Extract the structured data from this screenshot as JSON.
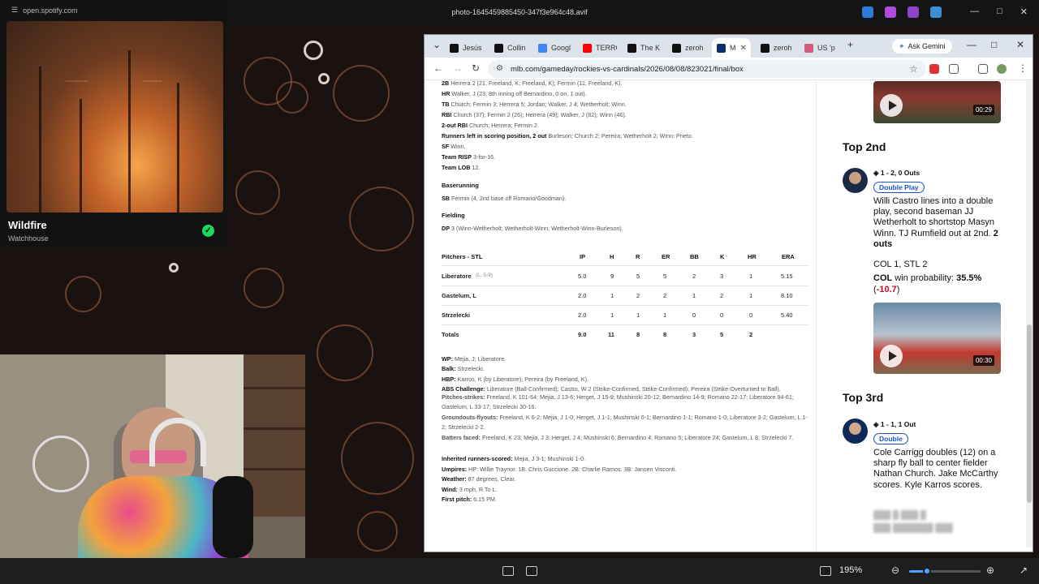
{
  "viewer": {
    "title": "photo-1645459885450-347f3e964c48.avif",
    "zoom": "195%",
    "zoom_level": 0.25
  },
  "spotify": {
    "url": "open.spotify.com",
    "track": "Wildfire",
    "artist": "Watchhouse"
  },
  "browser": {
    "tabs": [
      {
        "label": "Jesús",
        "favicon": "x-icon"
      },
      {
        "label": "Collin",
        "favicon": "x-icon"
      },
      {
        "label": "Googl",
        "favicon": "google-icon"
      },
      {
        "label": "TERRC",
        "favicon": "youtube-icon"
      },
      {
        "label": "The K",
        "favicon": "x-icon"
      },
      {
        "label": "zeroh",
        "favicon": "x-icon"
      },
      {
        "label": "M",
        "favicon": "mlb-icon",
        "active": true
      },
      {
        "label": "zeroh",
        "favicon": "x-icon"
      },
      {
        "label": "US 'p",
        "favicon": "shield-icon"
      }
    ],
    "gemini_label": "Ask Gemini",
    "url": "mlb.com/gameday/rockies-vs-cardinals/2026/08/08/823021/final/box"
  },
  "box": {
    "batting_lines": [
      {
        "label": "2B",
        "text": "Herrera 2 (21, Freeland, K; Freeland, K); Fermin (11, Freeland, K)."
      },
      {
        "label": "HR",
        "text": "Walker, J (23, 8th inning off Bernardino, 0 on, 1 out)."
      },
      {
        "label": "TB",
        "text": "Church; Fermin 3; Herrera 5; Jordan; Walker, J 4; Wetherholt; Winn."
      },
      {
        "label": "RBI",
        "text": "Church (37); Fermin 2 (26); Herrera (49); Walker, J (82); Winn (46)."
      },
      {
        "label": "2-out RBI",
        "text": "Church; Herrera; Fermin 2."
      },
      {
        "label": "Runners left in scoring position, 2 out",
        "text": "Burleson; Church 2; Pereira; Wetherholt 2; Winn; Prieto."
      },
      {
        "label": "SF",
        "text": "Winn."
      },
      {
        "label": "Team RISP",
        "text": "3-for-16."
      },
      {
        "label": "Team LOB",
        "text": "12."
      }
    ],
    "baserunning_title": "Baserunning",
    "baserunning": {
      "label": "SB",
      "text": "Fermin (4, 2nd base off Romano/Goodman)."
    },
    "fielding_title": "Fielding",
    "fielding": {
      "label": "DP",
      "text": "3 (Winn-Wetherholt; Wetherholt-Winn; Wetherholt-Winn-Burleson)."
    },
    "pitchers": {
      "header": [
        "Pitchers - STL",
        "IP",
        "H",
        "R",
        "ER",
        "BB",
        "K",
        "HR",
        "ERA"
      ],
      "rows": [
        {
          "name": "Liberatore",
          "note": "(L, 5-9)",
          "stats": [
            "5.0",
            "9",
            "5",
            "5",
            "2",
            "3",
            "1",
            "5.15"
          ]
        },
        {
          "name": "Gastelum, L",
          "note": "",
          "stats": [
            "2.0",
            "1",
            "2",
            "2",
            "1",
            "2",
            "1",
            "8.10"
          ]
        },
        {
          "name": "Strzelecki",
          "note": "",
          "stats": [
            "2.0",
            "1",
            "1",
            "1",
            "0",
            "0",
            "0",
            "5.40"
          ]
        },
        {
          "name": "Totals",
          "note": "",
          "stats": [
            "9.0",
            "11",
            "8",
            "8",
            "3",
            "5",
            "2",
            ""
          ]
        }
      ]
    },
    "game_notes": [
      {
        "label": "WP:",
        "text": "Mejia, J; Liberatore."
      },
      {
        "label": "Balk:",
        "text": "Strzelecki."
      },
      {
        "label": "HBP:",
        "text": "Karros, K (by Liberatore); Pereira (by Freeland, K)."
      },
      {
        "label": "ABS Challenge:",
        "text": "Liberatore (Ball-Confirmed); Castro, W 2 (Strike-Confirmed, Strike-Confirmed); Pereira (Strike-Overturned to Ball)."
      },
      {
        "label": "Pitches-strikes:",
        "text": "Freeland, K 101-64; Mejia, J 13-6; Herget, J 15-9; Mushinski 20-12; Bernardino 14-9; Romano 22-17; Liberatore 94-61; Gastelum, L 33-17; Strzelecki 30-16."
      },
      {
        "label": "Groundouts-flyouts:",
        "text": "Freeland, K 6-2; Mejia, J 1-0; Herget, J 1-1; Mushinski 0-1; Bernardino 1-1; Romano 1-0; Liberatore 3-2; Gastelum, L 1-2; Strzelecki 2-2."
      },
      {
        "label": "Batters faced:",
        "text": "Freeland, K 23; Mejia, J 3; Herget, J 4; Mushinski 6; Bernardino 4; Romano 5; Liberatore 24; Gastelum, L 8; Strzelecki 7."
      },
      {
        "label": "Inherited runners-scored:",
        "text": "Mejia, J 3-1; Mushinski 1-0."
      },
      {
        "label": "Umpires:",
        "text": "HP: Willie Traynor. 1B: Chris Guccione. 2B: Charlie Ramos. 3B: Jansen Visconti."
      },
      {
        "label": "Weather:",
        "text": "87 degrees, Clear."
      },
      {
        "label": "Wind:",
        "text": "3 mph, R To L."
      },
      {
        "label": "First pitch:",
        "text": "6:15 PM."
      }
    ]
  },
  "pbp": {
    "video1_duration": "00:29",
    "top2": {
      "inning": "Top 2nd",
      "count": "1 - 2, 0 Outs",
      "badge": "Double Play",
      "desc": "Willi Castro lines into a double play, second baseman JJ Wetherholt to shortstop Masyn Winn. TJ Rumfield out at 2nd.",
      "outs": "2 outs",
      "score": "COL 1, STL 2",
      "wp_team": "COL",
      "wp_label": "win probability:",
      "wp_value": "35.5%",
      "wp_delta": "-10.7",
      "video_duration": "00:30"
    },
    "top3": {
      "inning": "Top 3rd",
      "count": "1 - 1, 1 Out",
      "badge": "Double",
      "desc": "Cole Carrigg doubles (12) on a sharp fly ball to center fielder Nathan Church. Jake McCarthy scores. Kyle Karros scores."
    }
  }
}
